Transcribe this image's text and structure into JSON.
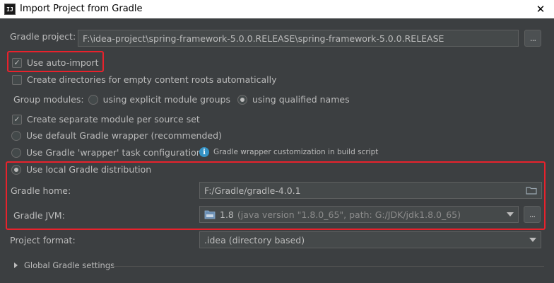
{
  "window": {
    "app_icon_text": "IJ",
    "title": "Import Project from Gradle",
    "close_icon": "close-icon"
  },
  "gradle_project": {
    "label": "Gradle project:",
    "value": "F:\\idea-project\\spring-framework-5.0.0.RELEASE\\spring-framework-5.0.0.RELEASE",
    "browse_label": "..."
  },
  "options": {
    "auto_import": {
      "label": "Use auto-import",
      "checked": true
    },
    "create_dirs": {
      "label": "Create directories for empty content roots automatically",
      "checked": false
    },
    "group_modules": {
      "label": "Group modules:",
      "explicit": {
        "label": "using explicit module groups",
        "selected": false
      },
      "qualified": {
        "label": "using qualified names",
        "selected": true
      }
    },
    "separate_module": {
      "label": "Create separate module per source set",
      "checked": true
    },
    "default_wrapper": {
      "label": "Use default Gradle wrapper (recommended)",
      "selected": false
    },
    "wrapper_task": {
      "label": "Use Gradle 'wrapper' task configuration",
      "selected": false
    },
    "wrapper_hint": {
      "icon": "info-icon",
      "text": "Gradle wrapper customization in build script"
    },
    "local_distribution": {
      "label": "Use local Gradle distribution",
      "selected": true
    }
  },
  "gradle_home": {
    "label": "Gradle home:",
    "value": "F:/Gradle/gradle-4.0.1",
    "icon": "folder-icon"
  },
  "gradle_jvm": {
    "label": "Gradle JVM:",
    "version": "1.8",
    "detail": "(java version \"1.8.0_65\", path: G:/JDK/jdk1.8.0_65)",
    "browse_label": "..."
  },
  "project_format": {
    "label": "Project format:",
    "value": ".idea (directory based)"
  },
  "global_settings": {
    "label": "Global Gradle settings"
  },
  "colors": {
    "background": "#3c3f41",
    "highlight": "#e8222c",
    "text": "#bbbbbb",
    "info": "#3592c4"
  }
}
